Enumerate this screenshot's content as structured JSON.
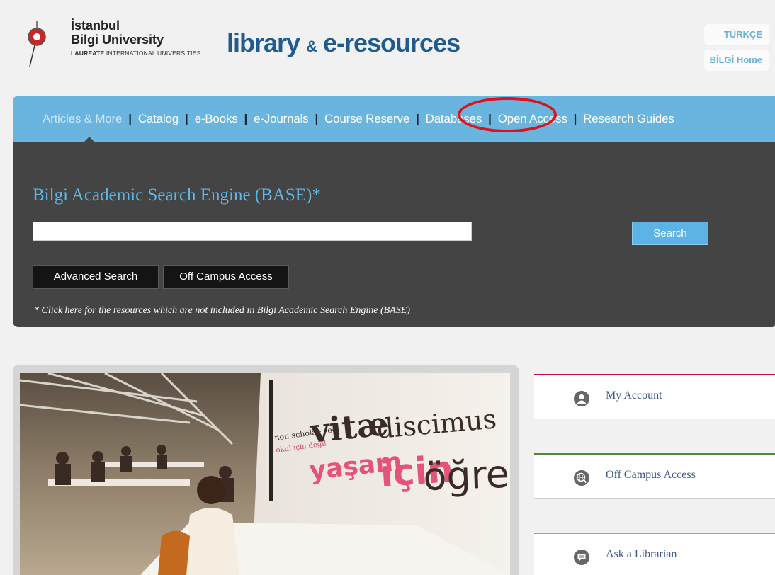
{
  "header": {
    "university_line1": "İstanbul",
    "university_line2": "Bilgi University",
    "university_line3_bold": "LAUREATE",
    "university_line3_rest": "INTERNATIONAL UNIVERSITIES",
    "site_title_a": "library",
    "site_title_amp": "&",
    "site_title_b": "e-resources",
    "lang_button": "TÜRKÇE",
    "home_button": "BİLGİ Home"
  },
  "nav": {
    "items": [
      {
        "label": "Articles & More",
        "active": true
      },
      {
        "label": "Catalog"
      },
      {
        "label": "e-Books"
      },
      {
        "label": "e-Journals"
      },
      {
        "label": "Course Reserve"
      },
      {
        "label": "Databases"
      },
      {
        "label": "Open Access"
      },
      {
        "label": "Research Guides"
      }
    ],
    "separator": "|",
    "highlight_color": "#e0111b"
  },
  "search": {
    "title": "Bilgi Academic Search Engine (BASE)*",
    "input_value": "",
    "search_button": "Search",
    "advanced_button": "Advanced Search",
    "off_campus_button": "Off Campus Access",
    "note_prefix": "* ",
    "note_link": "Click here",
    "note_rest": " for the resources which are not included in Bilgi Academic Search Engine (BASE)"
  },
  "hero": {
    "text_small_1": "non scholae sed",
    "text_small_2": "okul için değil",
    "text_vitae": "vitæ",
    "text_discimus": "discimus",
    "text_yasam": "yaşam",
    "text_icin": "için",
    "text_ogren": "öğren"
  },
  "sidebar": {
    "items": [
      {
        "label": "My Account",
        "icon": "user-icon",
        "color": "#c4163e"
      },
      {
        "label": "Off Campus Access",
        "icon": "globe-search-icon",
        "color": "#4d8b2c"
      },
      {
        "label": "Ask a Librarian",
        "icon": "chat-icon",
        "color": "#6ab4e0"
      }
    ]
  },
  "colors": {
    "brand_blue": "#1f5b8e",
    "nav_blue": "#6ab4e0",
    "panel_dark": "#444444",
    "title_cyan": "#5fb7e8"
  }
}
